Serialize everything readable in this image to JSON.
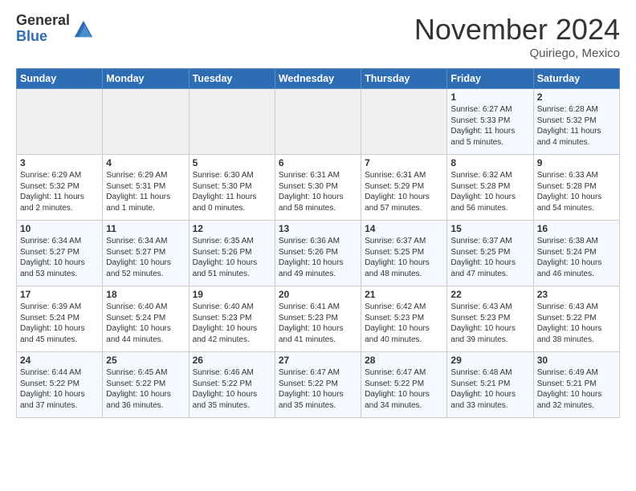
{
  "header": {
    "logo_general": "General",
    "logo_blue": "Blue",
    "month_title": "November 2024",
    "location": "Quiriego, Mexico"
  },
  "days_of_week": [
    "Sunday",
    "Monday",
    "Tuesday",
    "Wednesday",
    "Thursday",
    "Friday",
    "Saturday"
  ],
  "weeks": [
    [
      {
        "day": "",
        "info": ""
      },
      {
        "day": "",
        "info": ""
      },
      {
        "day": "",
        "info": ""
      },
      {
        "day": "",
        "info": ""
      },
      {
        "day": "",
        "info": ""
      },
      {
        "day": "1",
        "info": "Sunrise: 6:27 AM\nSunset: 5:33 PM\nDaylight: 11 hours\nand 5 minutes."
      },
      {
        "day": "2",
        "info": "Sunrise: 6:28 AM\nSunset: 5:32 PM\nDaylight: 11 hours\nand 4 minutes."
      }
    ],
    [
      {
        "day": "3",
        "info": "Sunrise: 6:29 AM\nSunset: 5:32 PM\nDaylight: 11 hours\nand 2 minutes."
      },
      {
        "day": "4",
        "info": "Sunrise: 6:29 AM\nSunset: 5:31 PM\nDaylight: 11 hours\nand 1 minute."
      },
      {
        "day": "5",
        "info": "Sunrise: 6:30 AM\nSunset: 5:30 PM\nDaylight: 11 hours\nand 0 minutes."
      },
      {
        "day": "6",
        "info": "Sunrise: 6:31 AM\nSunset: 5:30 PM\nDaylight: 10 hours\nand 58 minutes."
      },
      {
        "day": "7",
        "info": "Sunrise: 6:31 AM\nSunset: 5:29 PM\nDaylight: 10 hours\nand 57 minutes."
      },
      {
        "day": "8",
        "info": "Sunrise: 6:32 AM\nSunset: 5:28 PM\nDaylight: 10 hours\nand 56 minutes."
      },
      {
        "day": "9",
        "info": "Sunrise: 6:33 AM\nSunset: 5:28 PM\nDaylight: 10 hours\nand 54 minutes."
      }
    ],
    [
      {
        "day": "10",
        "info": "Sunrise: 6:34 AM\nSunset: 5:27 PM\nDaylight: 10 hours\nand 53 minutes."
      },
      {
        "day": "11",
        "info": "Sunrise: 6:34 AM\nSunset: 5:27 PM\nDaylight: 10 hours\nand 52 minutes."
      },
      {
        "day": "12",
        "info": "Sunrise: 6:35 AM\nSunset: 5:26 PM\nDaylight: 10 hours\nand 51 minutes."
      },
      {
        "day": "13",
        "info": "Sunrise: 6:36 AM\nSunset: 5:26 PM\nDaylight: 10 hours\nand 49 minutes."
      },
      {
        "day": "14",
        "info": "Sunrise: 6:37 AM\nSunset: 5:25 PM\nDaylight: 10 hours\nand 48 minutes."
      },
      {
        "day": "15",
        "info": "Sunrise: 6:37 AM\nSunset: 5:25 PM\nDaylight: 10 hours\nand 47 minutes."
      },
      {
        "day": "16",
        "info": "Sunrise: 6:38 AM\nSunset: 5:24 PM\nDaylight: 10 hours\nand 46 minutes."
      }
    ],
    [
      {
        "day": "17",
        "info": "Sunrise: 6:39 AM\nSunset: 5:24 PM\nDaylight: 10 hours\nand 45 minutes."
      },
      {
        "day": "18",
        "info": "Sunrise: 6:40 AM\nSunset: 5:24 PM\nDaylight: 10 hours\nand 44 minutes."
      },
      {
        "day": "19",
        "info": "Sunrise: 6:40 AM\nSunset: 5:23 PM\nDaylight: 10 hours\nand 42 minutes."
      },
      {
        "day": "20",
        "info": "Sunrise: 6:41 AM\nSunset: 5:23 PM\nDaylight: 10 hours\nand 41 minutes."
      },
      {
        "day": "21",
        "info": "Sunrise: 6:42 AM\nSunset: 5:23 PM\nDaylight: 10 hours\nand 40 minutes."
      },
      {
        "day": "22",
        "info": "Sunrise: 6:43 AM\nSunset: 5:23 PM\nDaylight: 10 hours\nand 39 minutes."
      },
      {
        "day": "23",
        "info": "Sunrise: 6:43 AM\nSunset: 5:22 PM\nDaylight: 10 hours\nand 38 minutes."
      }
    ],
    [
      {
        "day": "24",
        "info": "Sunrise: 6:44 AM\nSunset: 5:22 PM\nDaylight: 10 hours\nand 37 minutes."
      },
      {
        "day": "25",
        "info": "Sunrise: 6:45 AM\nSunset: 5:22 PM\nDaylight: 10 hours\nand 36 minutes."
      },
      {
        "day": "26",
        "info": "Sunrise: 6:46 AM\nSunset: 5:22 PM\nDaylight: 10 hours\nand 35 minutes."
      },
      {
        "day": "27",
        "info": "Sunrise: 6:47 AM\nSunset: 5:22 PM\nDaylight: 10 hours\nand 35 minutes."
      },
      {
        "day": "28",
        "info": "Sunrise: 6:47 AM\nSunset: 5:22 PM\nDaylight: 10 hours\nand 34 minutes."
      },
      {
        "day": "29",
        "info": "Sunrise: 6:48 AM\nSunset: 5:21 PM\nDaylight: 10 hours\nand 33 minutes."
      },
      {
        "day": "30",
        "info": "Sunrise: 6:49 AM\nSunset: 5:21 PM\nDaylight: 10 hours\nand 32 minutes."
      }
    ]
  ]
}
